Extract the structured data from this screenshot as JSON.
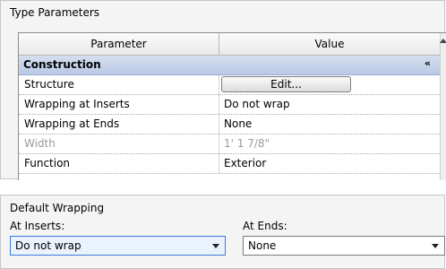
{
  "type_parameters": {
    "title": "Type Parameters",
    "columns": {
      "parameter": "Parameter",
      "value": "Value"
    },
    "group": {
      "label": "Construction",
      "collapse_glyph": "«"
    },
    "rows": [
      {
        "name": "Structure",
        "value": "Edit...",
        "kind": "button"
      },
      {
        "name": "Wrapping at Inserts",
        "value": "Do not wrap"
      },
      {
        "name": "Wrapping at Ends",
        "value": "None"
      },
      {
        "name": "Width",
        "value": "1'  1 7/8\"",
        "disabled": true
      },
      {
        "name": "Function",
        "value": "Exterior"
      }
    ]
  },
  "default_wrapping": {
    "title": "Default Wrapping",
    "at_inserts_label": "At Inserts:",
    "at_inserts_value": "Do not wrap",
    "at_ends_label": "At Ends:",
    "at_ends_value": "None"
  },
  "colors": {
    "group_header": "#c6d3ea",
    "focus_border": "#3a7bd5",
    "disabled_text": "#9a9a9a"
  }
}
